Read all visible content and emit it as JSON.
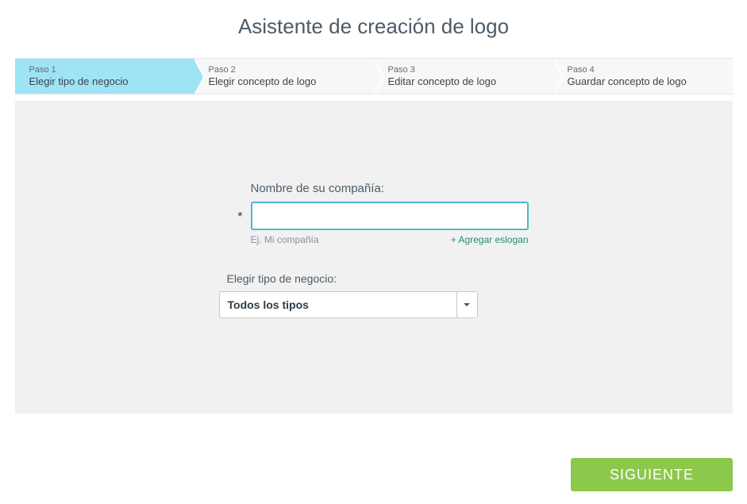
{
  "page": {
    "title": "Asistente de creación de logo"
  },
  "stepper": {
    "steps": [
      {
        "small": "Paso 1",
        "main": "Elegir tipo de negocio"
      },
      {
        "small": "Paso 2",
        "main": "Elegir concepto de logo"
      },
      {
        "small": "Paso 3",
        "main": "Editar concepto de logo"
      },
      {
        "small": "Paso 4",
        "main": "Guardar concepto de logo"
      }
    ]
  },
  "form": {
    "company_label": "Nombre de su compañía:",
    "asterisk": "*",
    "company_value": "",
    "company_hint": "Ej. Mi compañía",
    "add_slogan": "+ Agregar eslogan",
    "type_label": "Elegir tipo de negocio:",
    "type_selected": "Todos los tipos"
  },
  "buttons": {
    "next": "SIGUIENTE"
  }
}
